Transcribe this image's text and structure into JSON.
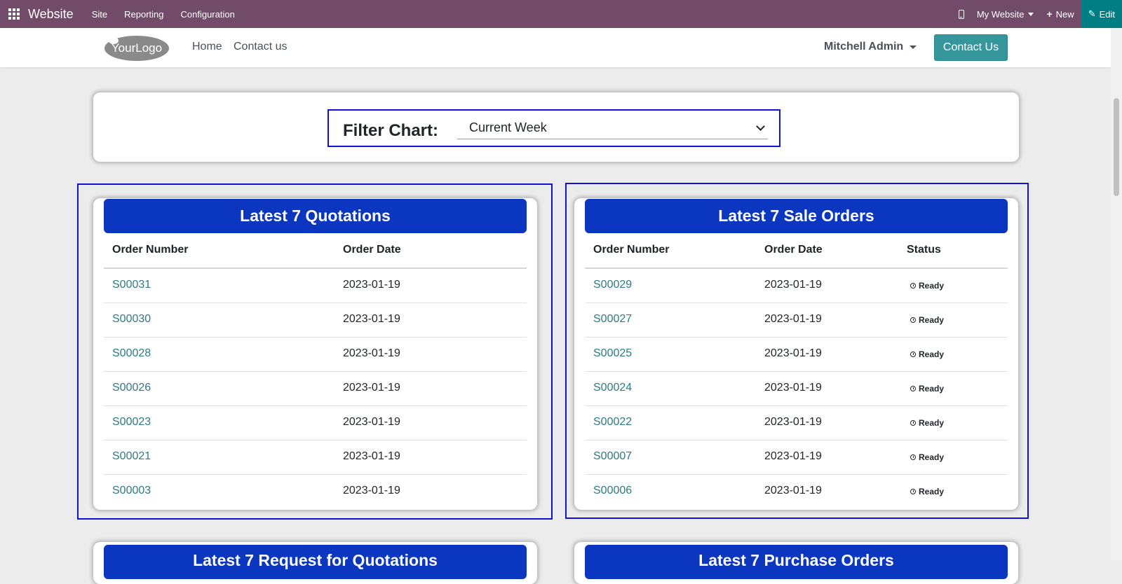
{
  "topbar": {
    "brand": "Website",
    "menus": [
      "Site",
      "Reporting",
      "Configuration"
    ],
    "my_website": "My Website",
    "new_label": "New",
    "edit_label": "Edit",
    "bg_color": "#714b67"
  },
  "header": {
    "logo_text": "YourLogo",
    "nav": [
      "Home",
      "Contact us"
    ],
    "user": "Mitchell Admin",
    "contact_button": "Contact Us"
  },
  "filter": {
    "label": "Filter Chart:",
    "selected": "Current Week"
  },
  "quotations": {
    "title": "Latest 7 Quotations",
    "columns": [
      "Order Number",
      "Order Date"
    ],
    "rows": [
      {
        "number": "S00031",
        "date": "2023-01-19"
      },
      {
        "number": "S00030",
        "date": "2023-01-19"
      },
      {
        "number": "S00028",
        "date": "2023-01-19"
      },
      {
        "number": "S00026",
        "date": "2023-01-19"
      },
      {
        "number": "S00023",
        "date": "2023-01-19"
      },
      {
        "number": "S00021",
        "date": "2023-01-19"
      },
      {
        "number": "S00003",
        "date": "2023-01-19"
      }
    ]
  },
  "sale_orders": {
    "title": "Latest 7 Sale Orders",
    "columns": [
      "Order Number",
      "Order Date",
      "Status"
    ],
    "rows": [
      {
        "number": "S00029",
        "date": "2023-01-19",
        "status": "Ready"
      },
      {
        "number": "S00027",
        "date": "2023-01-19",
        "status": "Ready"
      },
      {
        "number": "S00025",
        "date": "2023-01-19",
        "status": "Ready"
      },
      {
        "number": "S00024",
        "date": "2023-01-19",
        "status": "Ready"
      },
      {
        "number": "S00022",
        "date": "2023-01-19",
        "status": "Ready"
      },
      {
        "number": "S00007",
        "date": "2023-01-19",
        "status": "Ready"
      },
      {
        "number": "S00006",
        "date": "2023-01-19",
        "status": "Ready"
      }
    ]
  },
  "bottom_panels": {
    "left_title": "Latest 7 Request for Quotations",
    "right_title": "Latest 7 Purchase Orders"
  },
  "colors": {
    "panel_header": "#0a36c0",
    "highlight": "#1010d8",
    "link": "#2f7a7e",
    "contact_button": "#35979c"
  }
}
